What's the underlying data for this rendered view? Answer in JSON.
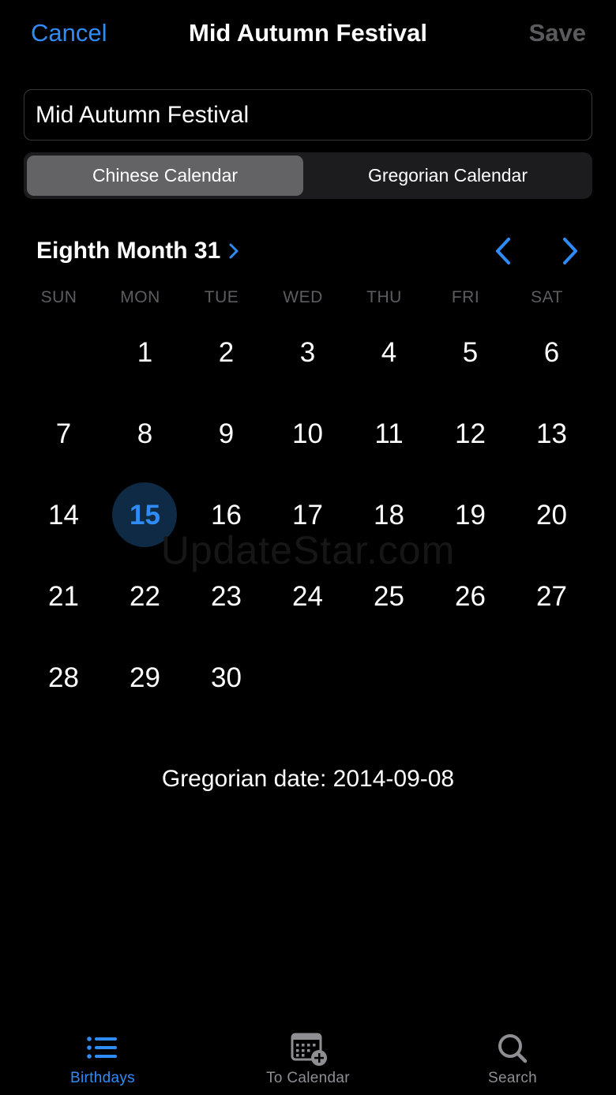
{
  "nav": {
    "cancel_label": "Cancel",
    "title": "Mid Autumn Festival",
    "save_label": "Save"
  },
  "name_field": {
    "value": "Mid Autumn Festival"
  },
  "segment": {
    "chinese": "Chinese Calendar",
    "gregorian": "Gregorian Calendar",
    "selected": "chinese"
  },
  "calendar": {
    "month_title": "Eighth Month 31",
    "weekdays": [
      "SUN",
      "MON",
      "TUE",
      "WED",
      "THU",
      "FRI",
      "SAT"
    ],
    "days": [
      "",
      "1",
      "2",
      "3",
      "4",
      "5",
      "6",
      "7",
      "8",
      "9",
      "10",
      "11",
      "12",
      "13",
      "14",
      "15",
      "16",
      "17",
      "18",
      "19",
      "20",
      "21",
      "22",
      "23",
      "24",
      "25",
      "26",
      "27",
      "28",
      "29",
      "30"
    ],
    "selected_day": "15"
  },
  "watermark": "UpdateStar.com",
  "gregorian_date": "Gregorian date: 2014-09-08",
  "tabs": [
    {
      "label": "Birthdays",
      "icon": "list-icon",
      "active": true
    },
    {
      "label": "To Calendar",
      "icon": "calendar-add-icon",
      "active": false
    },
    {
      "label": "Search",
      "icon": "search-icon",
      "active": false
    }
  ],
  "colors": {
    "accent": "#2f8cf7",
    "background": "#000000",
    "inactive": "#8e8e93"
  }
}
